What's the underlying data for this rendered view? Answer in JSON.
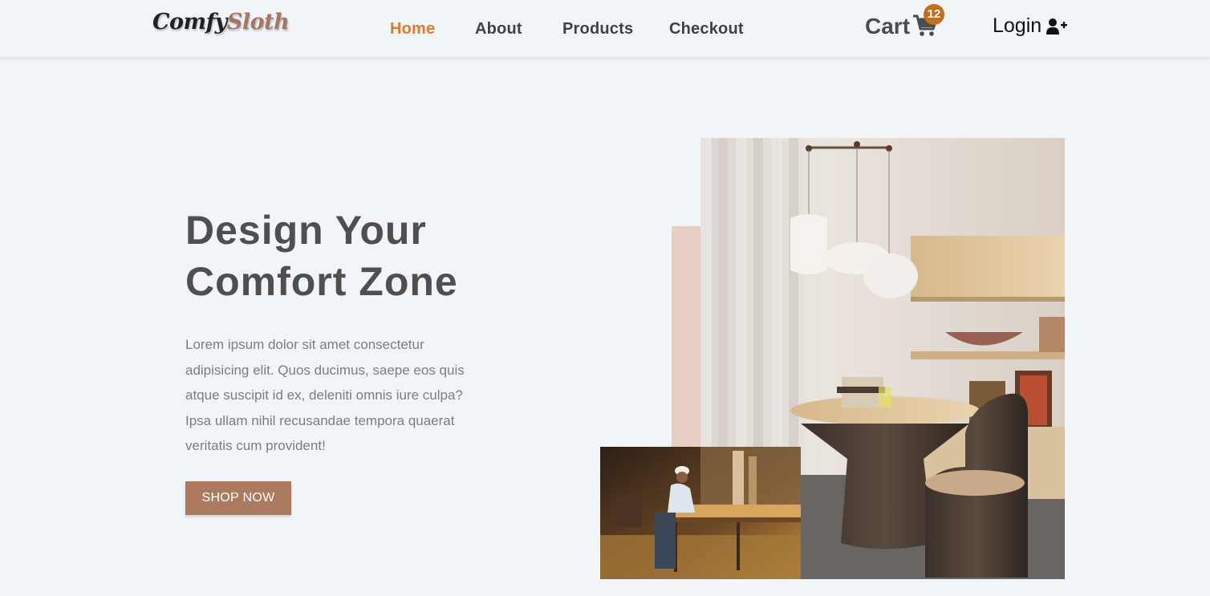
{
  "brand": {
    "part1": "Comfy",
    "part2": "Sloth"
  },
  "nav": {
    "links": [
      {
        "label": "Home",
        "active": true
      },
      {
        "label": "About",
        "active": false
      },
      {
        "label": "Products",
        "active": false
      },
      {
        "label": "Checkout",
        "active": false
      }
    ],
    "cart_label": "Cart",
    "cart_count": "12",
    "login_label": "Login",
    "cart_icon": "shopping-cart-icon",
    "login_icon": "user-plus-icon"
  },
  "hero": {
    "title": "Design Your Comfort Zone",
    "text": "Lorem ipsum dolor sit amet consectetur adipisicing elit. Quos ducimus, saepe eos quis atque suscipit id ex, deleniti omnis iure culpa? Ipsa ullam nihil recusandae tempora quaerat veritatis cum provident!",
    "button_label": "SHOP NOW"
  },
  "colors": {
    "background": "#f1f5f8",
    "accent_orange": "#e07a2e",
    "badge": "#c36d1f",
    "button": "#ab7a5f",
    "accent_block": "#e8cfc5"
  }
}
